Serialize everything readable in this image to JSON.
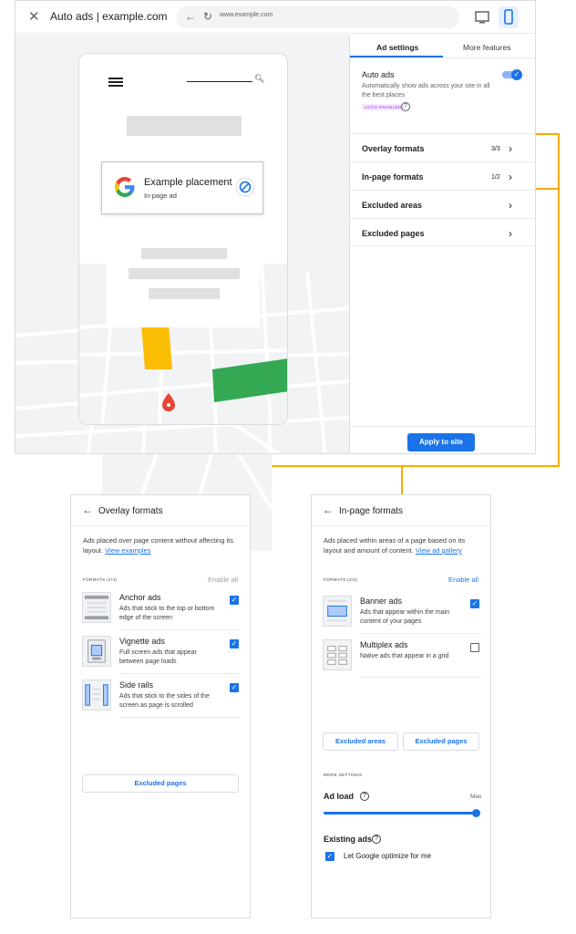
{
  "browser": {
    "title": "Auto ads | example.com",
    "url": "www.example.com",
    "accent": "#1a73e8",
    "highlight_color": "#f9ab00"
  },
  "preview": {
    "placement_title": "Example placement",
    "placement_subtitle": "In-page ad"
  },
  "panel": {
    "tabs": [
      "Ad settings",
      "More features"
    ],
    "auto_ads": {
      "title": "Auto ads",
      "description": "Automatically show ads across your site in all the best places",
      "badge": "AUTO-ENABLED",
      "enabled": true
    },
    "rows": [
      {
        "label": "Overlay formats",
        "count": "3/3"
      },
      {
        "label": "In-page formats",
        "count": "1/2"
      },
      {
        "label": "Excluded areas",
        "count": ""
      },
      {
        "label": "Excluded pages",
        "count": ""
      }
    ],
    "apply_label": "Apply to site"
  },
  "overlay_card": {
    "title": "Overlay formats",
    "desc_text": "Ads placed over page content without affecting its layout. ",
    "desc_link": "View examples",
    "section_label": "FORMATS (4/4)",
    "section_action": "Enable all",
    "formats": [
      {
        "name": "Anchor ads",
        "desc": "Ads that stick to the top or bottom edge of the screen",
        "checked": true
      },
      {
        "name": "Vignette ads",
        "desc": "Full screen ads that appear between page loads",
        "checked": true
      },
      {
        "name": "Side rails",
        "desc": "Ads that stick to the sides of the screen as page is scrolled",
        "checked": true
      }
    ],
    "excluded_pages_label": "Excluded pages"
  },
  "inpage_card": {
    "title": "In-page formats",
    "desc_text": "Ads placed within areas of a page based on its layout and amount of content. ",
    "desc_link": "View ad gallery",
    "section_label": "FORMATS (2/3)",
    "section_action": "Enable all",
    "formats": [
      {
        "name": "Banner ads",
        "desc": "Ads that appear within the main content of your pages",
        "checked": true
      },
      {
        "name": "Multiplex ads",
        "desc": "Native ads that appear in a grid",
        "checked": false
      }
    ],
    "excluded_areas_label": "Excluded areas",
    "excluded_pages_label": "Excluded pages",
    "more_settings_label": "MORE SETTINGS",
    "ad_load_label": "Ad load",
    "ad_load_max_label": "Max",
    "ad_load_level": 1.0,
    "existing_ads_label": "Existing ads",
    "optimize_label": "Let Google optimize for me",
    "optimize_checked": true
  }
}
